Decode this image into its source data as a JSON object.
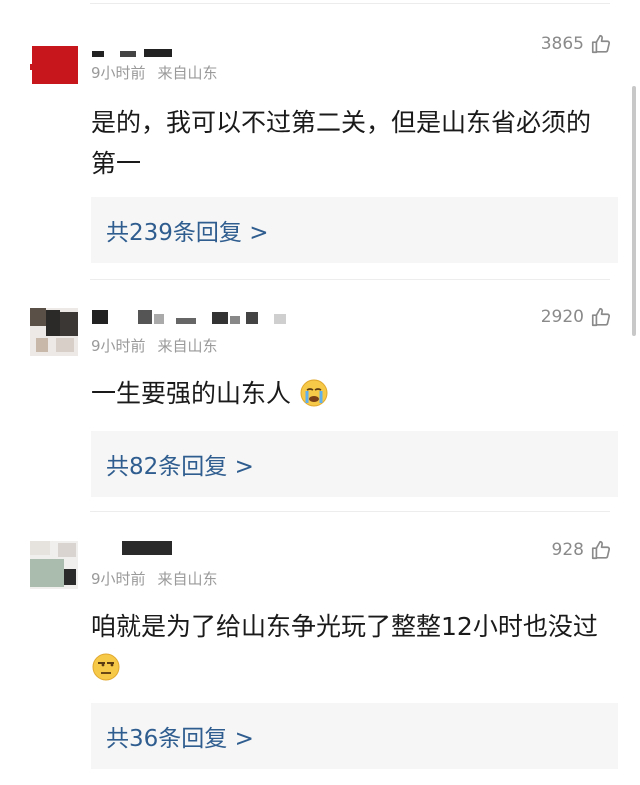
{
  "comments": [
    {
      "time": "9小时前",
      "location": "来自山东",
      "likes": "3865",
      "content": "是的，我可以不过第二关，但是山东省必须的第一",
      "replies": "共239条回复 >"
    },
    {
      "time": "9小时前",
      "location": "来自山东",
      "likes": "2920",
      "content": "一生要强的山东人",
      "emoji": "crying-face-emoji",
      "replies": "共82条回复 >"
    },
    {
      "time": "9小时前",
      "location": "来自山东",
      "likes": "928",
      "content": "咱就是为了给山东争光玩了整整12小时也没过",
      "emoji": "unamused-face-emoji",
      "replies": "共36条回复 >"
    }
  ],
  "icons": {
    "like": "thumbs-up-icon"
  },
  "colors": {
    "reply_link": "#2f5d8f",
    "meta_text": "#9a9a9a",
    "reply_bg": "#f6f6f6"
  }
}
